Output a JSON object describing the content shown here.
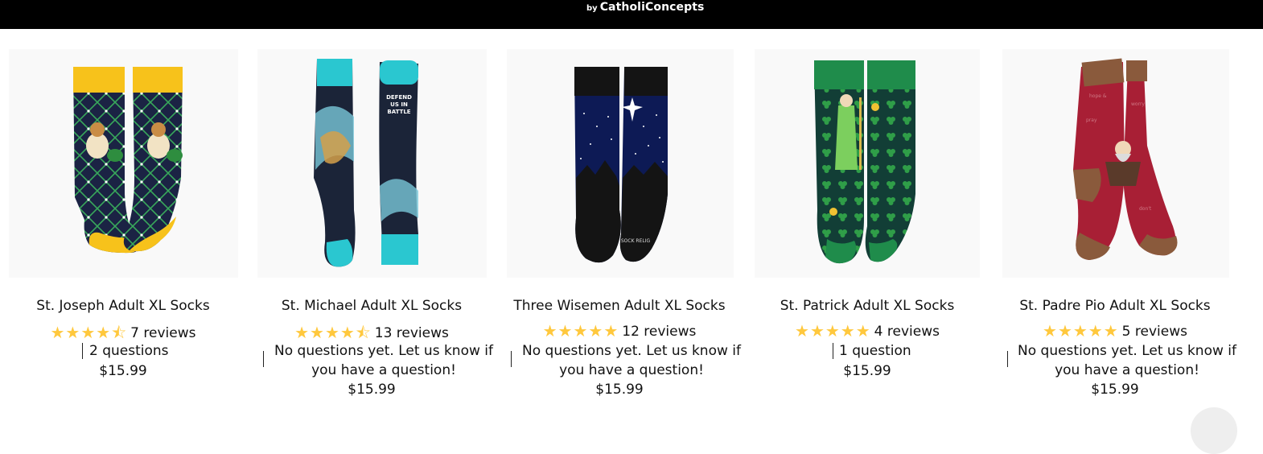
{
  "header": {
    "brand_prefix": "by",
    "brand_name": "CatholiConcepts"
  },
  "products": [
    {
      "title": "St. Joseph Adult XL Socks",
      "stars": "★★★★⯪",
      "rating": 4.5,
      "reviews": "7 reviews",
      "questions": "2 questions",
      "price": "$15.99",
      "image_icon": "st-joseph-socks-image"
    },
    {
      "title": "St. Michael Adult XL Socks",
      "stars": "★★★★⯪",
      "rating": 4.5,
      "reviews": "13 reviews",
      "questions": "No questions yet. Let us know if you have a question!",
      "price": "$15.99",
      "image_icon": "st-michael-socks-image"
    },
    {
      "title": "Three Wisemen Adult XL Socks",
      "stars": "★★★★★",
      "rating": 5,
      "reviews": "12 reviews",
      "questions": "No questions yet. Let us know if you have a question!",
      "price": "$15.99",
      "image_icon": "three-wisemen-socks-image"
    },
    {
      "title": "St. Patrick Adult XL Socks",
      "stars": "★★★★★",
      "rating": 5,
      "reviews": "4 reviews",
      "questions": "1 question",
      "price": "$15.99",
      "image_icon": "st-patrick-socks-image"
    },
    {
      "title": "St. Padre Pio Adult XL Socks",
      "stars": "★★★★★",
      "rating": 5,
      "reviews": "5 reviews",
      "questions": "No questions yet. Let us know if you have a question!",
      "price": "$15.99",
      "image_icon": "st-padre-pio-socks-image"
    }
  ],
  "sock_labels": {
    "michael_sole": "DEFEND US IN BATTLE",
    "brand_tag": "SOCK RELIGIOUS"
  },
  "colors": {
    "star": "#ffc83d",
    "topbar": "#000000"
  }
}
